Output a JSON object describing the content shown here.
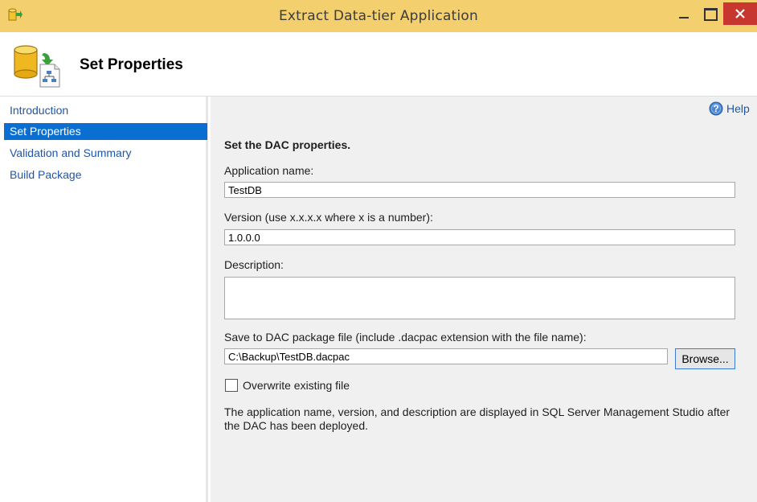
{
  "window": {
    "title": "Extract Data-tier Application",
    "icon": "dac-app-icon",
    "controls": [
      "minimize-icon",
      "maximize-icon",
      "close-icon"
    ],
    "close_color": "#c7362f",
    "titlebar_color": "#f3cf6e"
  },
  "header": {
    "title": "Set Properties",
    "icon": "database-package-icon"
  },
  "sidebar": {
    "items": [
      {
        "label": "Introduction",
        "selected": false
      },
      {
        "label": "Set Properties",
        "selected": true
      },
      {
        "label": "Validation and Summary",
        "selected": false
      },
      {
        "label": "Build Package",
        "selected": false
      }
    ],
    "selected_color": "#0b6fd1",
    "link_color": "#1f56a8"
  },
  "main": {
    "help_label": "Help",
    "help_icon": "help-icon",
    "section_title": "Set the DAC properties.",
    "app_name_label": "Application name:",
    "app_name_value": "TestDB",
    "version_label": "Version (use x.x.x.x where x is a number):",
    "version_value": "1.0.0.0",
    "description_label": "Description:",
    "description_value": "",
    "save_label": "Save to DAC package file (include .dacpac extension with the file name):",
    "save_value": "C:\\Backup\\TestDB.dacpac",
    "browse_label": "Browse...",
    "overwrite_label": "Overwrite existing file",
    "overwrite_checked": false,
    "note": "The application name, version, and description are displayed in SQL Server Management Studio after the DAC has been deployed."
  }
}
